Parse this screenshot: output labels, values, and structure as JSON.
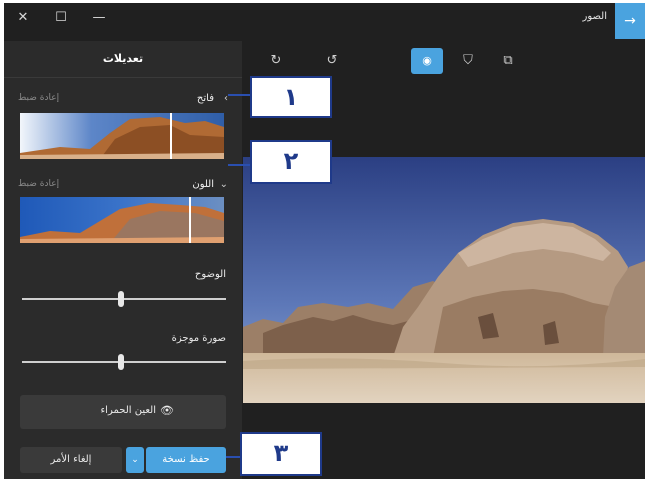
{
  "window": {
    "app_title": "الصور",
    "controls": {
      "close": "✕",
      "maximize": "☐",
      "minimize": "—"
    },
    "back_icon": "→"
  },
  "toolbar": {
    "redo_icon": "↻",
    "undo_icon": "↺",
    "view_icon": "◉",
    "filter_icon": "⛉",
    "crop_icon": "⧉"
  },
  "panel": {
    "title": "تعديلات",
    "sections": [
      {
        "label": "فاتح",
        "reset_label": "إعادة ضبط",
        "chevron": "‹"
      },
      {
        "label": "اللون",
        "reset_label": "إعادة ضبط",
        "chevron": "⌄"
      }
    ],
    "sliders": [
      {
        "label": "الوضوح",
        "value": 0.5
      },
      {
        "label": "صورة موجزة",
        "value": 0.5
      }
    ],
    "red_eye": {
      "label": "العين الحمراء",
      "icon": "👁"
    },
    "cancel_label": "إلغاء الأمر",
    "save_label": "حفظ نسخة",
    "save_dropdown_icon": "⌄"
  },
  "callouts": [
    {
      "number": "١"
    },
    {
      "number": "٢"
    },
    {
      "number": "٣"
    }
  ]
}
